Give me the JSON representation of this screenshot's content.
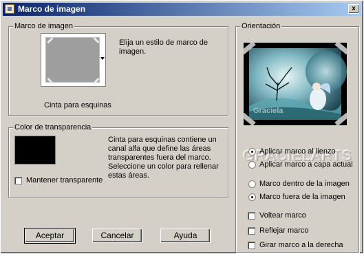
{
  "window": {
    "title": "Marco de imagen",
    "close_label": "x"
  },
  "frame_group": {
    "legend": "Marco de imagen",
    "description": "Elija un estilo de marco de imagen.",
    "frame_name": "Cinta para esquinas"
  },
  "transparency_group": {
    "legend": "Color de transparencia",
    "description": "Cinta para esquinas contiene un canal alfa que define las áreas transparentes fuera del marco. Seleccione un color para rellenar estas áreas.",
    "keep_transparent_label": "Mantener transparente",
    "keep_transparent_checked": false,
    "swatch_color": "#000000"
  },
  "orientation_group": {
    "legend": "Orientación",
    "watermark": "GRACIELARTS",
    "image_signature": "Graciela",
    "radio_apply": [
      {
        "label": "Aplicar marco al lienzo",
        "checked": true
      },
      {
        "label": "Aplicar marco a capa actual",
        "checked": false
      }
    ],
    "radio_position": [
      {
        "label": "Marco dentro de la imagen",
        "checked": false
      },
      {
        "label": "Marco fuera de la imagen",
        "checked": true
      }
    ],
    "checkboxes": [
      {
        "label": "Voltear marco",
        "checked": false
      },
      {
        "label": "Reflejar marco",
        "checked": false
      },
      {
        "label": "Girar marco a la derecha",
        "checked": false
      }
    ]
  },
  "buttons": {
    "accept": "Aceptar",
    "cancel": "Cancelar",
    "help": "Ayuda"
  }
}
